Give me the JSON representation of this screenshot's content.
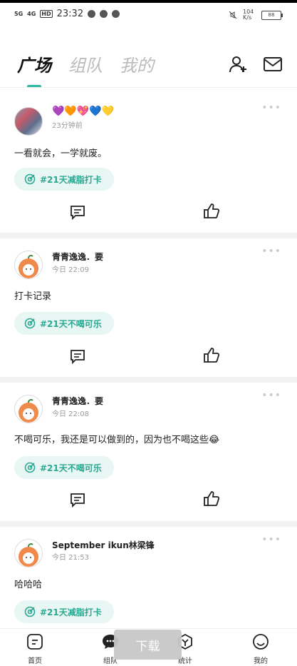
{
  "status_bar": {
    "signal1": "5G",
    "signal2": "4G",
    "hd": "HD",
    "time": "23:32",
    "net_speed": "104 K/s",
    "battery": "88"
  },
  "nav": {
    "tabs": [
      {
        "label": "广场"
      },
      {
        "label": "组队"
      },
      {
        "label": "我的"
      }
    ],
    "active_tab": "广场",
    "accent_color": "#2db8a4"
  },
  "posts": [
    {
      "user": "💜🧡💖💙💛",
      "time": "23分钟前",
      "content": "一看就会，一学就废。",
      "tag": "#21天减脂打卡"
    },
    {
      "user": "青青逸逸．要",
      "time": "今日 22:09",
      "content": "打卡记录",
      "tag": "#21天不喝可乐"
    },
    {
      "user": "青青逸逸．要",
      "time": "今日 22:08",
      "content": "不喝可乐，我还是可以做到的，因为也不喝这些😂",
      "tag": "#21天不喝可乐"
    },
    {
      "user": "September ikun林梁锋",
      "time": "今日 21:53",
      "content": "哈哈哈",
      "tag": "#21天减脂打卡"
    }
  ],
  "more_label": "•••",
  "download_label": "下载",
  "bottom_nav": [
    {
      "label": "首页"
    },
    {
      "label": "组队"
    },
    {
      "label": "统计"
    },
    {
      "label": "我的"
    }
  ]
}
